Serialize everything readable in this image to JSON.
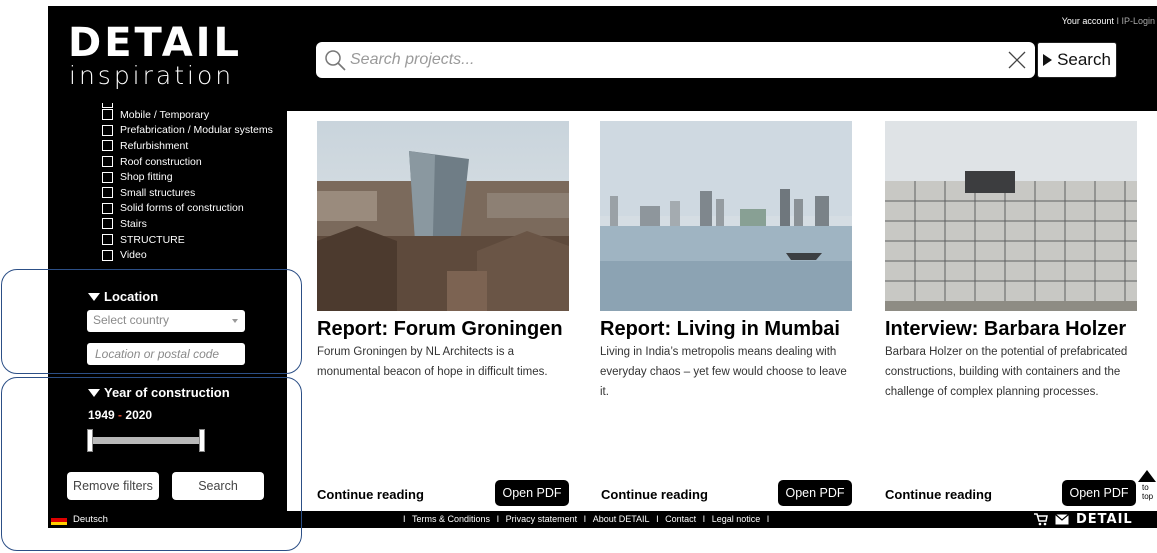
{
  "header": {
    "logo_main": "DETAIL",
    "logo_sub": "inspiration",
    "top_links": {
      "account": "Your account",
      "separator": "I",
      "ip_login": "IP-Login"
    },
    "search": {
      "placeholder": "Search projects...",
      "value": "",
      "button_label": "Search"
    }
  },
  "sidebar": {
    "categories": [
      {
        "label": "Mobile / Temporary"
      },
      {
        "label": "Prefabrication / Modular systems"
      },
      {
        "label": "Refurbishment"
      },
      {
        "label": "Roof construction"
      },
      {
        "label": "Shop fitting"
      },
      {
        "label": "Small structures"
      },
      {
        "label": "Solid forms of construction"
      },
      {
        "label": "Stairs"
      },
      {
        "label": "STRUCTURE"
      },
      {
        "label": "Video"
      }
    ],
    "location": {
      "title": "Location",
      "country_placeholder": "Select country",
      "postal_placeholder": "Location or postal code"
    },
    "year": {
      "title": "Year of construction",
      "from": "1949",
      "dash": "-",
      "to": "2020"
    },
    "remove_filters_label": "Remove filters",
    "search_label": "Search"
  },
  "cards": [
    {
      "title": "Report: Forum Groningen",
      "text": "Forum Groningen by NL Architects is a monumental beacon of hope in difficult times.",
      "continue_label": "Continue reading",
      "pdf_label": "Open PDF",
      "image": "groningen-aerial-photo"
    },
    {
      "title": "Report: Living in Mumbai",
      "text": "Living in India’s metropolis means dealing with everyday chaos – yet few would choose to leave it.",
      "continue_label": "Continue reading",
      "pdf_label": "Open PDF",
      "image": "mumbai-skyline-photo"
    },
    {
      "title": "Interview: Barbara Holzer",
      "text": "Barbara Holzer on the potential of prefabricated constructions, building with containers and the challenge of complex planning processes.",
      "continue_label": "Continue reading",
      "pdf_label": "Open PDF",
      "image": "container-building-photo"
    }
  ],
  "to_top": {
    "line1": "to",
    "line2": "top"
  },
  "footer": {
    "language": "Deutsch",
    "links": [
      "Terms & Conditions",
      "Privacy statement",
      "About DETAIL",
      "Contact",
      "Legal notice"
    ],
    "separator": "I",
    "logo": "DETAIL"
  },
  "colors": {
    "background": "#000000",
    "accent": "#e04a2f",
    "annotation": "#2c4f86"
  },
  "icons": {
    "search": "magnifier-icon",
    "clear": "x-icon",
    "cart": "cart-icon",
    "mail": "mail-icon",
    "flag": "german-flag-icon"
  }
}
